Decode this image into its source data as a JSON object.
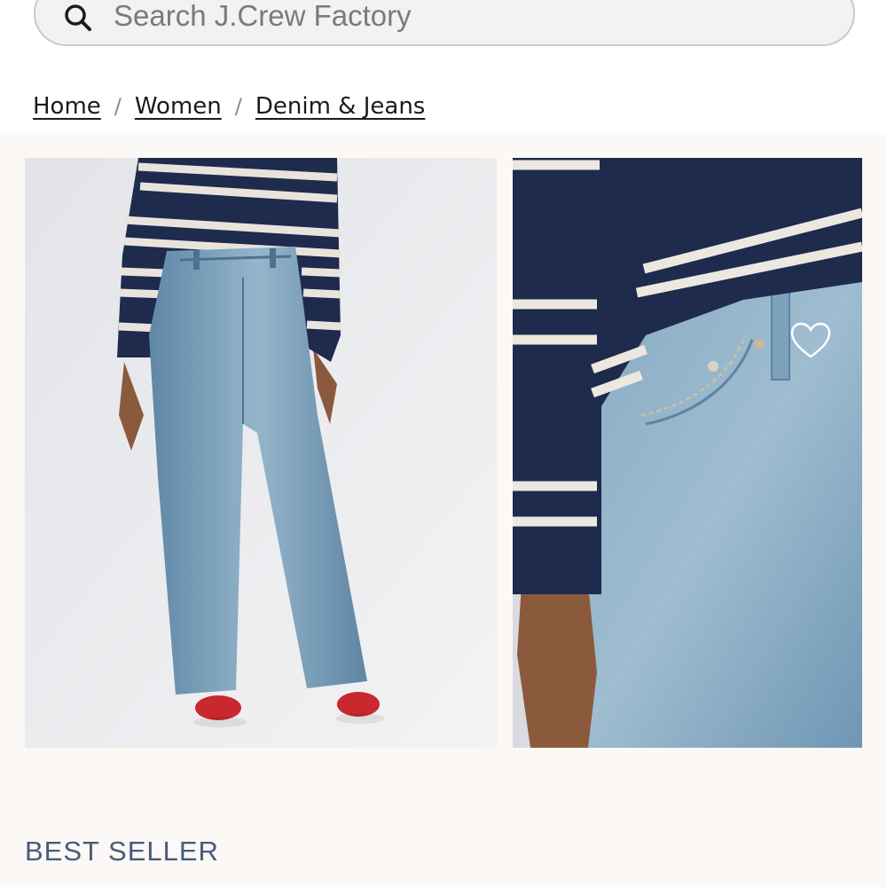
{
  "search": {
    "placeholder": "Search J.Crew Factory",
    "icon": "search-icon"
  },
  "breadcrumb": {
    "items": [
      {
        "label": "Home"
      },
      {
        "label": "Women"
      },
      {
        "label": "Denim & Jeans"
      }
    ],
    "separator": "/"
  },
  "gallery": {
    "images": [
      {
        "alt": "",
        "icon": "product-photo-full-body"
      },
      {
        "alt": "",
        "icon": "product-photo-detail"
      }
    ],
    "wishlist_icon": "heart-icon"
  },
  "product": {
    "badge": "BEST SELLER"
  },
  "colors": {
    "badge_text": "#475b7d",
    "gallery_bg": "#fbf8f5",
    "navy": "#1f2b4d",
    "denim": "#7fa3bd"
  }
}
